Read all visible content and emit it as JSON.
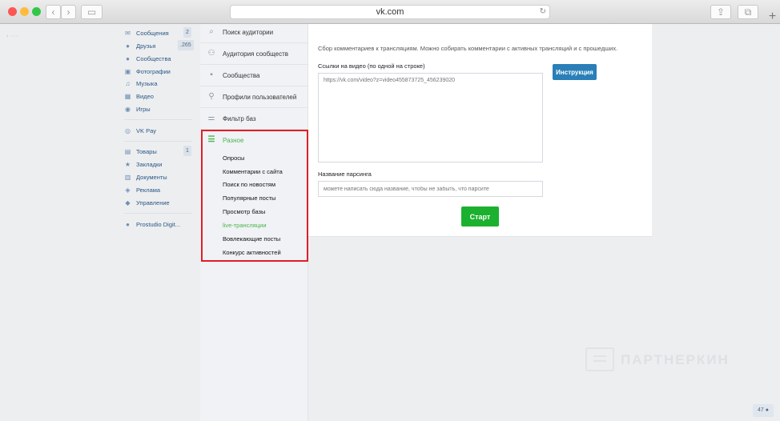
{
  "browser": {
    "url": "vk.com",
    "new_tab_symbol": "+"
  },
  "vk_menu": {
    "items": [
      {
        "label": "Сообщения",
        "icon": "messages-icon",
        "badge": "2"
      },
      {
        "label": "Друзья",
        "icon": "friends-icon",
        "badge": "265"
      },
      {
        "label": "Сообщества",
        "icon": "communities-icon"
      },
      {
        "label": "Фотографии",
        "icon": "photos-icon"
      },
      {
        "label": "Музыка",
        "icon": "music-icon"
      },
      {
        "label": "Видео",
        "icon": "video-icon"
      },
      {
        "label": "Игры",
        "icon": "games-icon"
      },
      {
        "label": "VK Pay",
        "icon": "vkpay-icon"
      },
      {
        "label": "Товары",
        "icon": "goods-icon",
        "badge": "1"
      },
      {
        "label": "Закладки",
        "icon": "bookmarks-star-icon"
      },
      {
        "label": "Документы",
        "icon": "documents-icon"
      },
      {
        "label": "Реклама",
        "icon": "ads-icon"
      },
      {
        "label": "Управление",
        "icon": "manage-icon"
      },
      {
        "label": "Prostudio Digit...",
        "icon": "group-icon"
      }
    ]
  },
  "app_menu": {
    "items": [
      {
        "label": "Поиск аудитории",
        "icon": "search-icon"
      },
      {
        "label": "Аудитория сообществ",
        "icon": "users-icon"
      },
      {
        "label": "Сообщества",
        "icon": "chat-icon"
      },
      {
        "label": "Профили пользователей",
        "icon": "profile-search-icon"
      },
      {
        "label": "Фильтр баз",
        "icon": "filter-icon"
      }
    ],
    "misc": {
      "label": "Разное",
      "sub_items": [
        "Опросы",
        "Комментарии с сайта",
        "Поиск по новостям",
        "Популярные посты",
        "Просмотр базы",
        "live-трансляции",
        "Вовлекающие посты",
        "Конкурс активностей"
      ]
    }
  },
  "main": {
    "description": "Сбор комментариев к трансляциям. Можно собирать комментарии с активных трансляций и с прошедших.",
    "links_label": "Ссылки на видео (по одной на строке)",
    "links_placeholder": "https://vk.com/video?z=video455873725_456239020",
    "instruction_button": "Инструкция",
    "name_label": "Название парсинга",
    "name_placeholder": "можете написать сюда название, чтобы не забыть, что парсите",
    "start_button": "Старт"
  },
  "watermark": {
    "text": "ПАРТНЕРКИН"
  },
  "bottom_badge": "47"
}
